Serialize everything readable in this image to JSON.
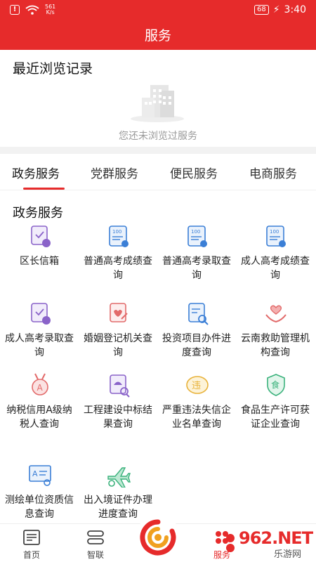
{
  "status_bar": {
    "speed": "561\nK/s",
    "battery": "68",
    "time": "3:40"
  },
  "header": {
    "title": "服务"
  },
  "recent": {
    "title": "最近浏览记录",
    "empty_text": "您还未浏览过服务"
  },
  "tabs": [
    {
      "label": "政务服务"
    },
    {
      "label": "党群服务"
    },
    {
      "label": "便民服务"
    },
    {
      "label": "电商服务"
    }
  ],
  "section": {
    "title": "政务服务"
  },
  "services": [
    {
      "label": "区长信箱",
      "icon": "mailbox-icon"
    },
    {
      "label": "普通高考成绩查询",
      "icon": "score-report-icon"
    },
    {
      "label": "普通高考录取查询",
      "icon": "admission-report-icon"
    },
    {
      "label": "成人高考成绩查询",
      "icon": "adult-exam-icon"
    },
    {
      "label": "成人高考录取查询",
      "icon": "admission-check-icon"
    },
    {
      "label": "婚姻登记机关查询",
      "icon": "marriage-icon"
    },
    {
      "label": "投资项目办件进度查询",
      "icon": "investment-search-icon"
    },
    {
      "label": "云南救助管理机构查询",
      "icon": "rescue-hands-icon"
    },
    {
      "label": "纳税信用A级纳税人查询",
      "icon": "tax-medal-icon"
    },
    {
      "label": "工程建设中标结果查询",
      "icon": "construction-bid-icon"
    },
    {
      "label": "严重违法失信企业名单查询",
      "icon": "violation-badge-icon"
    },
    {
      "label": "食品生产许可获证企业查询",
      "icon": "food-license-icon"
    },
    {
      "label": "测绘单位资质信息查询",
      "icon": "surveying-icon"
    },
    {
      "label": "出入境证件办理进度查询",
      "icon": "airplane-icon"
    }
  ],
  "bottom_nav": [
    {
      "label": "首页",
      "icon": "news-icon"
    },
    {
      "label": "智联",
      "icon": "link-icon"
    },
    {
      "label": "服务",
      "icon": "service-icon"
    }
  ],
  "watermark": {
    "text": "962.NET",
    "sub": "乐游网"
  },
  "colors": {
    "brand": "#e62b2b",
    "icon_blue": "#3b7fd6",
    "icon_purple": "#8a63c9",
    "icon_red": "#e26b6b",
    "icon_yellow": "#e8b23a",
    "icon_green": "#3bb27c"
  }
}
